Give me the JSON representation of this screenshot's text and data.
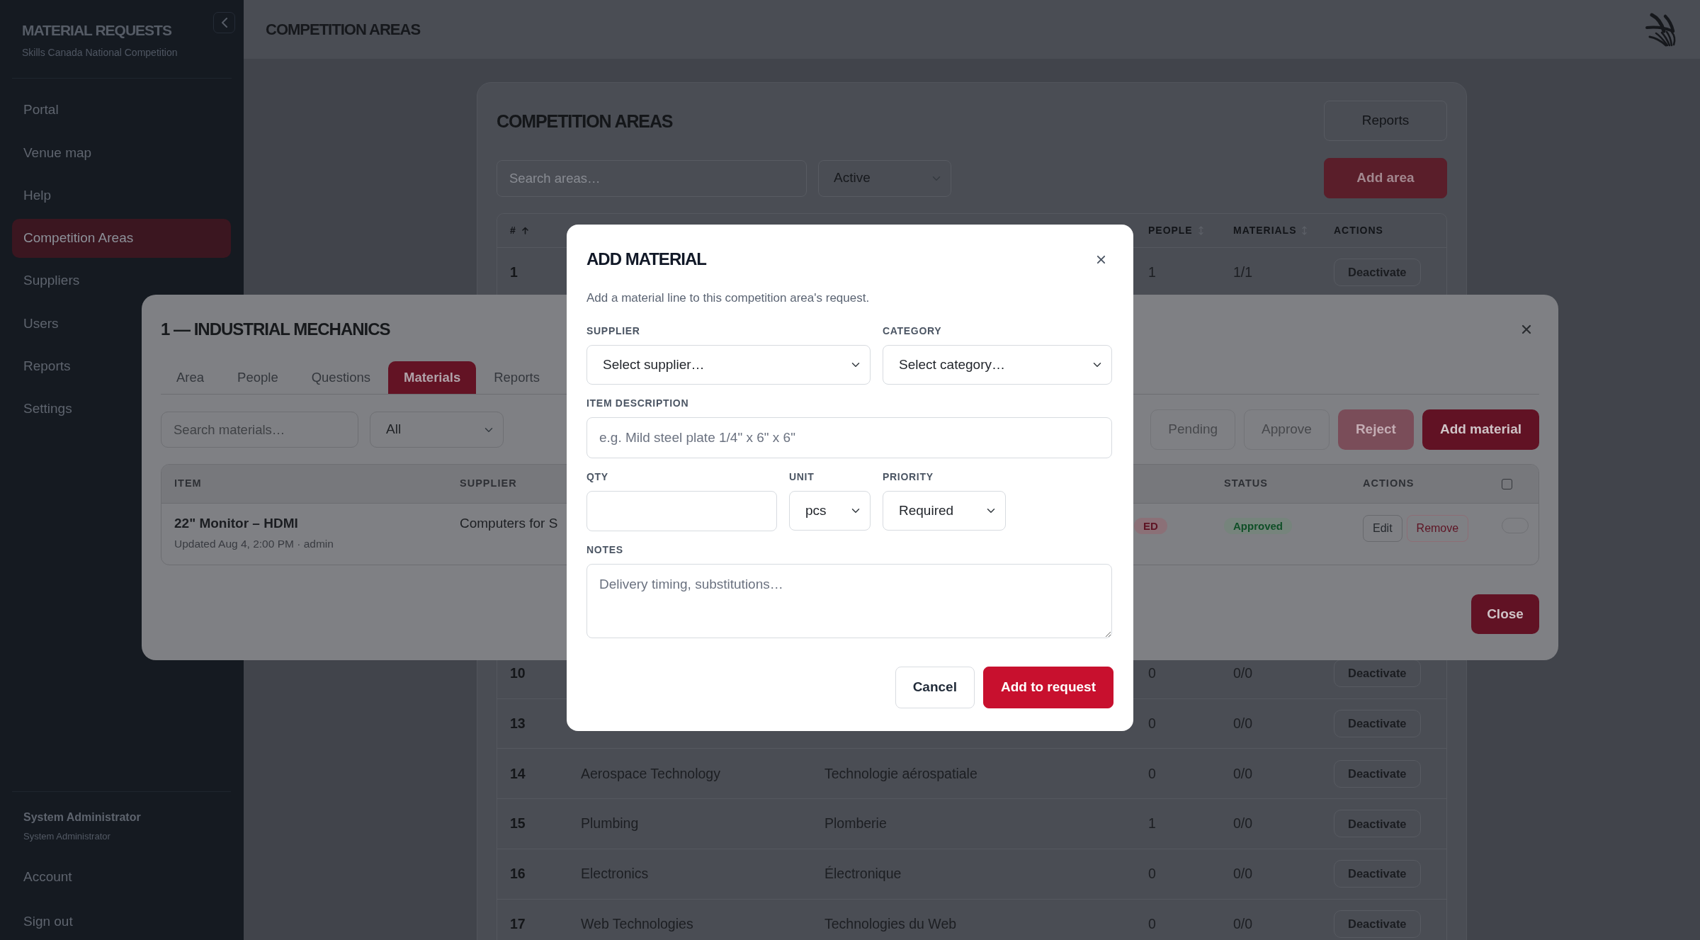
{
  "sidebar": {
    "title": "MATERIAL REQUESTS",
    "subtitle": "Skills Canada National Competition",
    "items": [
      {
        "label": "Portal",
        "selected": false
      },
      {
        "label": "Venue map",
        "selected": false
      },
      {
        "label": "Help",
        "selected": false
      },
      {
        "label": "Competition Areas",
        "selected": true
      },
      {
        "label": "Suppliers",
        "selected": false
      },
      {
        "label": "Users",
        "selected": false
      },
      {
        "label": "Reports",
        "selected": false
      },
      {
        "label": "Settings",
        "selected": false
      }
    ],
    "user": {
      "name": "System Administrator",
      "role": "System Administrator"
    },
    "footer_items": [
      "Account",
      "Sign out"
    ]
  },
  "topbar": {
    "title": "COMPETITION AREAS"
  },
  "page": {
    "title": "COMPETITION AREAS",
    "reports_button": "Reports",
    "search": {
      "placeholder": "Search areas…"
    },
    "status_filter": {
      "value": "Active"
    },
    "add_button": "Add area",
    "table": {
      "columns": {
        "number": {
          "label": "#",
          "sortable": true,
          "sorted": true
        },
        "people": {
          "label": "PEOPLE",
          "sortable": true,
          "sorted": false
        },
        "materials": {
          "label": "MATERIALS",
          "sortable": true,
          "sorted": false
        },
        "actions": {
          "label": "ACTIONS",
          "sortable": false
        }
      },
      "rows": [
        {
          "number": "1",
          "people": "1",
          "materials": "1/1",
          "action": "Deactivate"
        },
        {
          "number": "10",
          "people": "0",
          "materials": "0/0",
          "action": "Deactivate"
        },
        {
          "number": "13",
          "people": "0",
          "materials": "0/0",
          "action": "Deactivate"
        },
        {
          "number": "14",
          "column_2": "Aerospace Technology",
          "column_3": "Technologie aérospatiale",
          "people": "0",
          "materials": "0/0",
          "action": "Deactivate"
        },
        {
          "number": "15",
          "column_2": "Plumbing",
          "column_3": "Plomberie",
          "people": "1",
          "materials": "0/0",
          "action": "Deactivate"
        },
        {
          "number": "16",
          "column_2": "Electronics",
          "column_3": "Électronique",
          "people": "0",
          "materials": "0/0",
          "action": "Deactivate"
        },
        {
          "number": "17",
          "column_2": "Web Technologies",
          "column_3": "Technologies du Web",
          "people": "0",
          "materials": "0/0",
          "action": "Deactivate"
        }
      ]
    }
  },
  "area_modal": {
    "title": "1 — INDUSTRIAL MECHANICS",
    "tabs": [
      {
        "label": "Area",
        "selected": false
      },
      {
        "label": "People",
        "selected": false
      },
      {
        "label": "Questions",
        "selected": false
      },
      {
        "label": "Materials",
        "selected": true
      },
      {
        "label": "Reports",
        "selected": false
      }
    ],
    "search": {
      "placeholder": "Search materials…"
    },
    "status_filter": {
      "value": "All"
    },
    "actions": [
      {
        "label": "Pending",
        "kind": "outline",
        "disabled": true
      },
      {
        "label": "Approve",
        "kind": "outline",
        "disabled": true
      },
      {
        "label": "Reject",
        "kind": "danger",
        "disabled": true
      },
      {
        "label": "Add material",
        "kind": "primary",
        "disabled": false
      }
    ],
    "table": {
      "columns": {
        "item": "ITEM",
        "supplier": "SUPPLIER",
        "status": "STATUS",
        "actions": "ACTIONS"
      },
      "select_all": {
        "checked": false
      },
      "rows": [
        {
          "item": "22\" Monitor – HDMI",
          "updated": "Updated Aug 4, 2:00 PM · admin",
          "supplier": "Computers for S",
          "column_3": {
            "label": "ED",
            "kind": "danger"
          },
          "status": {
            "label": "Approved",
            "kind": "success"
          },
          "actions": [
            {
              "label": "Edit",
              "kind": "secondary"
            },
            {
              "label": "Remove",
              "kind": "danger"
            }
          ],
          "checked": false
        }
      ]
    },
    "close_button": "Close"
  },
  "add_material_modal": {
    "title": "ADD MATERIAL",
    "subtitle": "Add a material line to this competition area's request.",
    "fields": [
      {
        "label": "SUPPLIER",
        "kind": "select",
        "value": "Select supplier…"
      },
      {
        "label": "CATEGORY",
        "kind": "select",
        "value": "Select category…"
      },
      {
        "label": "ITEM DESCRIPTION",
        "kind": "input",
        "placeholder": "e.g. Mild steel plate 1/4\" x 6\" x 6\""
      },
      {
        "label": "QTY",
        "kind": "input"
      },
      {
        "label": "UNIT",
        "kind": "select",
        "value": "pcs"
      },
      {
        "label": "PRIORITY",
        "kind": "select",
        "value": "Required"
      },
      {
        "label": "NOTES",
        "kind": "textarea",
        "placeholder": "Delivery timing, substitutions…"
      }
    ],
    "buttons": [
      {
        "label": "Cancel",
        "kind": "secondary"
      },
      {
        "label": "Add to request",
        "kind": "primary"
      }
    ]
  }
}
